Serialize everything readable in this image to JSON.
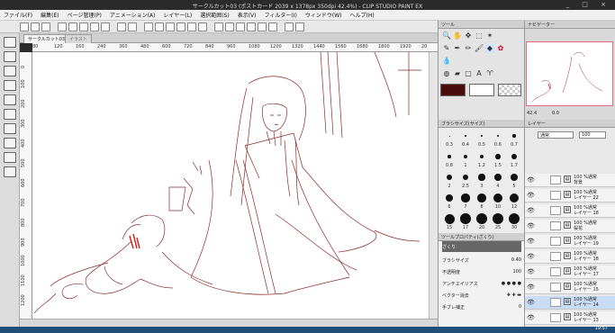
{
  "window": {
    "title": "サークルカット03 (ポストカード 2039 x 1378px 350dpi 42.4%) - CLIP STUDIO PAINT EX",
    "controls": "_ □ ×"
  },
  "menu": [
    "ファイル(F)",
    "編集(E)",
    "ページ管理(P)",
    "アニメーション(A)",
    "レイヤー(L)",
    "選択範囲(S)",
    "表示(V)",
    "フィルター(I)",
    "ウィンドウ(W)",
    "ヘルプ(H)"
  ],
  "doc_tabs": {
    "active": "サークルカット03",
    "close": "×",
    "second": "イラスト"
  },
  "ruler_top": [
    "80",
    "120",
    "160",
    "240",
    "360",
    "480",
    "600",
    "720",
    "840",
    "960",
    "1080",
    "1200",
    "1320",
    "1440",
    "1560",
    "1680",
    "1800",
    "1920",
    "20"
  ],
  "ruler_left": [
    "0",
    "100",
    "200",
    "300",
    "400",
    "500",
    "600",
    "700",
    "800",
    "900",
    "1000",
    "1100",
    "1200"
  ],
  "tool_panel": {
    "header": "ツール"
  },
  "brush_panel": {
    "header": "ブラシサイズ(サイズ)",
    "sizes_row1": [
      "0.3",
      "0.4",
      "0.5",
      "0.6",
      "0.7"
    ],
    "sizes_row2": [
      "0.8",
      "1",
      "1.2",
      "1.5",
      "1.7"
    ],
    "sizes_row3": [
      "2",
      "2.5",
      "3",
      "4",
      "5"
    ],
    "sizes_row4": [
      "6",
      "7",
      "8",
      "10",
      "12"
    ],
    "sizes_row5": [
      "15",
      "17",
      "20",
      "25",
      "30"
    ]
  },
  "prop_panel": {
    "header": "ツールプロパティ(ざくり)",
    "tool_name": "ざくり",
    "brush_size_label": "ブラシサイズ",
    "brush_size_value": "0.40",
    "opacity_label": "不透明度",
    "opacity_value": "100",
    "antialias_label": "アンチエイリアス",
    "vector_label": "ベクター消去",
    "stabilize_label": "手ブレ補正",
    "stabilize_value": "0"
  },
  "navigator": {
    "header": "ナビゲーター",
    "zoom": "42.4",
    "rotate": "0.0"
  },
  "layer_panel": {
    "header": "レイヤー",
    "blend": "通常",
    "opacity": "100",
    "layers": [
      {
        "opacity": "100 %通常",
        "name": "背景"
      },
      {
        "opacity": "100 %通常",
        "name": "レイヤー 22"
      },
      {
        "opacity": "100 %通常",
        "name": "レイヤー 18"
      },
      {
        "opacity": "100 %通常",
        "name": "桜花"
      },
      {
        "opacity": "100 %通常",
        "name": "レイヤー 19"
      },
      {
        "opacity": "100 %通常",
        "name": "レイヤー 18"
      },
      {
        "opacity": "100 %通常",
        "name": "レイヤー 17"
      },
      {
        "opacity": "100 %通常",
        "name": "レイヤー 15"
      },
      {
        "opacity": "100 %通常",
        "name": "レイヤー 14"
      },
      {
        "opacity": "100 %通常",
        "name": "レイヤー 13"
      }
    ]
  },
  "taskbar": {
    "clock": "19:57"
  },
  "colors": {
    "main_color": "#4a0d0d",
    "sub_color": "#ffffff",
    "line_color": "#8b2a2a",
    "accent": "#d01818"
  }
}
